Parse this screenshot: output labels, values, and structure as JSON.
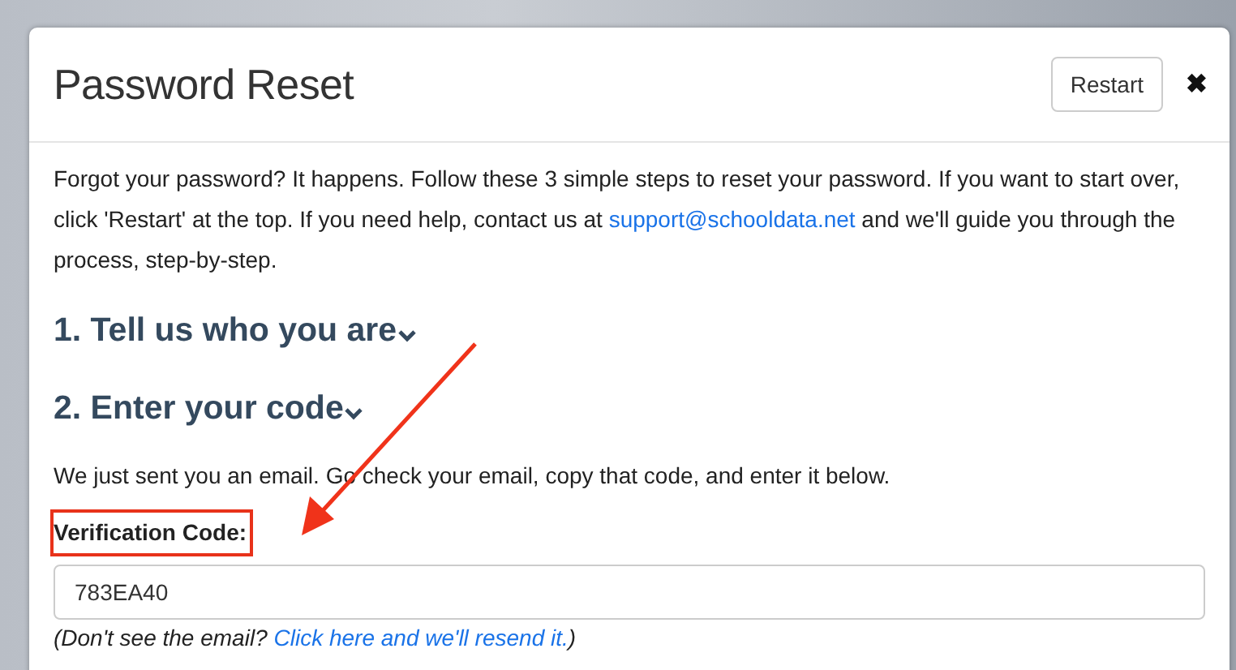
{
  "dialog": {
    "title": "Password Reset",
    "restart_button": "Restart",
    "close_icon": "✖"
  },
  "intro": {
    "before": "Forgot your password? It happens. Follow these 3 simple steps to reset your password. If you want to start over, click 'Restart' at the top. If you need help, contact us at ",
    "link": "support@schooldata.net",
    "after": " and we'll guide you through the process, step-by-step."
  },
  "steps": [
    {
      "title": "1. Tell us who you are"
    },
    {
      "title": "2. Enter your code"
    }
  ],
  "instruction": "We just sent you an email. Go check your email, copy that code, and enter it below.",
  "field": {
    "label": "Verification Code:",
    "highlighted": true,
    "value": "783EA40"
  },
  "hint": {
    "before": "(Don't see the email? ",
    "link": "Click here and we'll resend it.",
    "after": ")"
  }
}
